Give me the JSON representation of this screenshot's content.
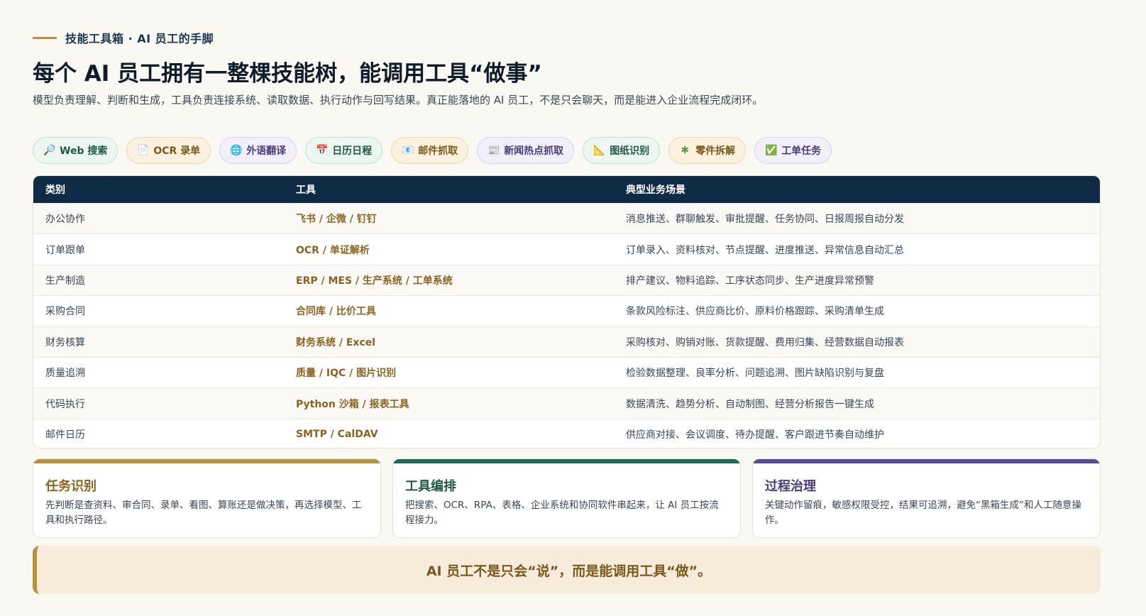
{
  "header": {
    "eyebrow": "技能工具箱 · AI 员工的手脚",
    "title": "每个 AI 员工拥有一整棵技能树，能调用工具“做事”",
    "subtitle": "模型负责理解、判断和生成，工具负责连接系统、读取数据、执行动作与回写结果。真正能落地的 AI 员工，不是只会聊天，而是能进入企业流程完成闭环。"
  },
  "chips": [
    {
      "label": "Web 搜索",
      "icon": "🔎"
    },
    {
      "label": "OCR 录单",
      "icon": "📄"
    },
    {
      "label": "外语翻译",
      "icon": "🌐"
    },
    {
      "label": "日历日程",
      "icon": "📅"
    },
    {
      "label": "邮件抓取",
      "icon": "📧"
    },
    {
      "label": "新闻热点抓取",
      "icon": "📰"
    },
    {
      "label": "图纸识别",
      "icon": "📐"
    },
    {
      "label": "零件拆解",
      "icon": "✱"
    },
    {
      "label": "工单任务",
      "icon": "✅"
    }
  ],
  "table": {
    "headers": [
      "类别",
      "工具",
      "典型业务场景"
    ],
    "rows": [
      [
        "办公协作",
        "飞书 / 企微 / 钉钉",
        "消息推送、群聊触发、审批提醒、任务协同、日报周报自动分发"
      ],
      [
        "订单跟单",
        "OCR / 单证解析",
        "订单录入、资料核对、节点提醒、进度推送、异常信息自动汇总"
      ],
      [
        "生产制造",
        "ERP / MES / 生产系统 / 工单系统",
        "排产建议、物料追踪、工序状态同步、生产进度异常预警"
      ],
      [
        "采购合同",
        "合同库 / 比价工具",
        "条款风险标注、供应商比价、原料价格跟踪、采购清单生成"
      ],
      [
        "财务核算",
        "财务系统 / Excel",
        "采购核对、购销对账、货款提醒、费用归集、经营数据自动报表"
      ],
      [
        "质量追溯",
        "质量 / IQC / 图片识别",
        "检验数据整理、良率分析、问题追溯、图片缺陷识别与复盘"
      ],
      [
        "代码执行",
        "Python 沙箱 / 报表工具",
        "数据清洗、趋势分析、自动制图、经营分析报告一键生成"
      ],
      [
        "邮件日历",
        "SMTP / CalDAV",
        "供应商对接、会议调度、待办提醒、客户跟进节奏自动维护"
      ]
    ]
  },
  "cards": [
    {
      "title": "任务识别",
      "text": "先判断是查资料、审合同、录单、看图、算账还是做决策，再选择模型、工具和执行路径。",
      "color": "#b8923a"
    },
    {
      "title": "工具编排",
      "text": "把搜索、OCR、RPA、表格、企业系统和协同软件串起来，让 AI 员工按流程接力。",
      "color": "#1f6a55"
    },
    {
      "title": "过程治理",
      "text": "关键动作留痕，敏感权限受控，结果可追溯，避免“黑箱生成”和人工随意操作。",
      "color": "#5a4a9a"
    }
  ],
  "banner": {
    "text": "AI 员工不是只会“说”，而是能调用工具“做”。"
  }
}
